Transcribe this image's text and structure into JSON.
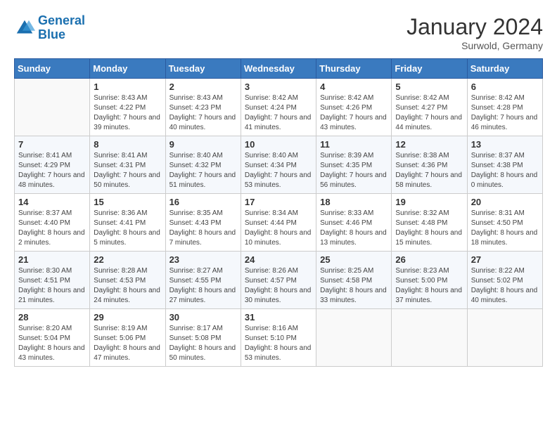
{
  "logo": {
    "line1": "General",
    "line2": "Blue"
  },
  "title": "January 2024",
  "subtitle": "Surwold, Germany",
  "days_of_week": [
    "Sunday",
    "Monday",
    "Tuesday",
    "Wednesday",
    "Thursday",
    "Friday",
    "Saturday"
  ],
  "weeks": [
    [
      {
        "day": "",
        "sunrise": "",
        "sunset": "",
        "daylight": ""
      },
      {
        "day": "1",
        "sunrise": "Sunrise: 8:43 AM",
        "sunset": "Sunset: 4:22 PM",
        "daylight": "Daylight: 7 hours and 39 minutes."
      },
      {
        "day": "2",
        "sunrise": "Sunrise: 8:43 AM",
        "sunset": "Sunset: 4:23 PM",
        "daylight": "Daylight: 7 hours and 40 minutes."
      },
      {
        "day": "3",
        "sunrise": "Sunrise: 8:42 AM",
        "sunset": "Sunset: 4:24 PM",
        "daylight": "Daylight: 7 hours and 41 minutes."
      },
      {
        "day": "4",
        "sunrise": "Sunrise: 8:42 AM",
        "sunset": "Sunset: 4:26 PM",
        "daylight": "Daylight: 7 hours and 43 minutes."
      },
      {
        "day": "5",
        "sunrise": "Sunrise: 8:42 AM",
        "sunset": "Sunset: 4:27 PM",
        "daylight": "Daylight: 7 hours and 44 minutes."
      },
      {
        "day": "6",
        "sunrise": "Sunrise: 8:42 AM",
        "sunset": "Sunset: 4:28 PM",
        "daylight": "Daylight: 7 hours and 46 minutes."
      }
    ],
    [
      {
        "day": "7",
        "sunrise": "Sunrise: 8:41 AM",
        "sunset": "Sunset: 4:29 PM",
        "daylight": "Daylight: 7 hours and 48 minutes."
      },
      {
        "day": "8",
        "sunrise": "Sunrise: 8:41 AM",
        "sunset": "Sunset: 4:31 PM",
        "daylight": "Daylight: 7 hours and 50 minutes."
      },
      {
        "day": "9",
        "sunrise": "Sunrise: 8:40 AM",
        "sunset": "Sunset: 4:32 PM",
        "daylight": "Daylight: 7 hours and 51 minutes."
      },
      {
        "day": "10",
        "sunrise": "Sunrise: 8:40 AM",
        "sunset": "Sunset: 4:34 PM",
        "daylight": "Daylight: 7 hours and 53 minutes."
      },
      {
        "day": "11",
        "sunrise": "Sunrise: 8:39 AM",
        "sunset": "Sunset: 4:35 PM",
        "daylight": "Daylight: 7 hours and 56 minutes."
      },
      {
        "day": "12",
        "sunrise": "Sunrise: 8:38 AM",
        "sunset": "Sunset: 4:36 PM",
        "daylight": "Daylight: 7 hours and 58 minutes."
      },
      {
        "day": "13",
        "sunrise": "Sunrise: 8:37 AM",
        "sunset": "Sunset: 4:38 PM",
        "daylight": "Daylight: 8 hours and 0 minutes."
      }
    ],
    [
      {
        "day": "14",
        "sunrise": "Sunrise: 8:37 AM",
        "sunset": "Sunset: 4:40 PM",
        "daylight": "Daylight: 8 hours and 2 minutes."
      },
      {
        "day": "15",
        "sunrise": "Sunrise: 8:36 AM",
        "sunset": "Sunset: 4:41 PM",
        "daylight": "Daylight: 8 hours and 5 minutes."
      },
      {
        "day": "16",
        "sunrise": "Sunrise: 8:35 AM",
        "sunset": "Sunset: 4:43 PM",
        "daylight": "Daylight: 8 hours and 7 minutes."
      },
      {
        "day": "17",
        "sunrise": "Sunrise: 8:34 AM",
        "sunset": "Sunset: 4:44 PM",
        "daylight": "Daylight: 8 hours and 10 minutes."
      },
      {
        "day": "18",
        "sunrise": "Sunrise: 8:33 AM",
        "sunset": "Sunset: 4:46 PM",
        "daylight": "Daylight: 8 hours and 13 minutes."
      },
      {
        "day": "19",
        "sunrise": "Sunrise: 8:32 AM",
        "sunset": "Sunset: 4:48 PM",
        "daylight": "Daylight: 8 hours and 15 minutes."
      },
      {
        "day": "20",
        "sunrise": "Sunrise: 8:31 AM",
        "sunset": "Sunset: 4:50 PM",
        "daylight": "Daylight: 8 hours and 18 minutes."
      }
    ],
    [
      {
        "day": "21",
        "sunrise": "Sunrise: 8:30 AM",
        "sunset": "Sunset: 4:51 PM",
        "daylight": "Daylight: 8 hours and 21 minutes."
      },
      {
        "day": "22",
        "sunrise": "Sunrise: 8:28 AM",
        "sunset": "Sunset: 4:53 PM",
        "daylight": "Daylight: 8 hours and 24 minutes."
      },
      {
        "day": "23",
        "sunrise": "Sunrise: 8:27 AM",
        "sunset": "Sunset: 4:55 PM",
        "daylight": "Daylight: 8 hours and 27 minutes."
      },
      {
        "day": "24",
        "sunrise": "Sunrise: 8:26 AM",
        "sunset": "Sunset: 4:57 PM",
        "daylight": "Daylight: 8 hours and 30 minutes."
      },
      {
        "day": "25",
        "sunrise": "Sunrise: 8:25 AM",
        "sunset": "Sunset: 4:58 PM",
        "daylight": "Daylight: 8 hours and 33 minutes."
      },
      {
        "day": "26",
        "sunrise": "Sunrise: 8:23 AM",
        "sunset": "Sunset: 5:00 PM",
        "daylight": "Daylight: 8 hours and 37 minutes."
      },
      {
        "day": "27",
        "sunrise": "Sunrise: 8:22 AM",
        "sunset": "Sunset: 5:02 PM",
        "daylight": "Daylight: 8 hours and 40 minutes."
      }
    ],
    [
      {
        "day": "28",
        "sunrise": "Sunrise: 8:20 AM",
        "sunset": "Sunset: 5:04 PM",
        "daylight": "Daylight: 8 hours and 43 minutes."
      },
      {
        "day": "29",
        "sunrise": "Sunrise: 8:19 AM",
        "sunset": "Sunset: 5:06 PM",
        "daylight": "Daylight: 8 hours and 47 minutes."
      },
      {
        "day": "30",
        "sunrise": "Sunrise: 8:17 AM",
        "sunset": "Sunset: 5:08 PM",
        "daylight": "Daylight: 8 hours and 50 minutes."
      },
      {
        "day": "31",
        "sunrise": "Sunrise: 8:16 AM",
        "sunset": "Sunset: 5:10 PM",
        "daylight": "Daylight: 8 hours and 53 minutes."
      },
      {
        "day": "",
        "sunrise": "",
        "sunset": "",
        "daylight": ""
      },
      {
        "day": "",
        "sunrise": "",
        "sunset": "",
        "daylight": ""
      },
      {
        "day": "",
        "sunrise": "",
        "sunset": "",
        "daylight": ""
      }
    ]
  ]
}
